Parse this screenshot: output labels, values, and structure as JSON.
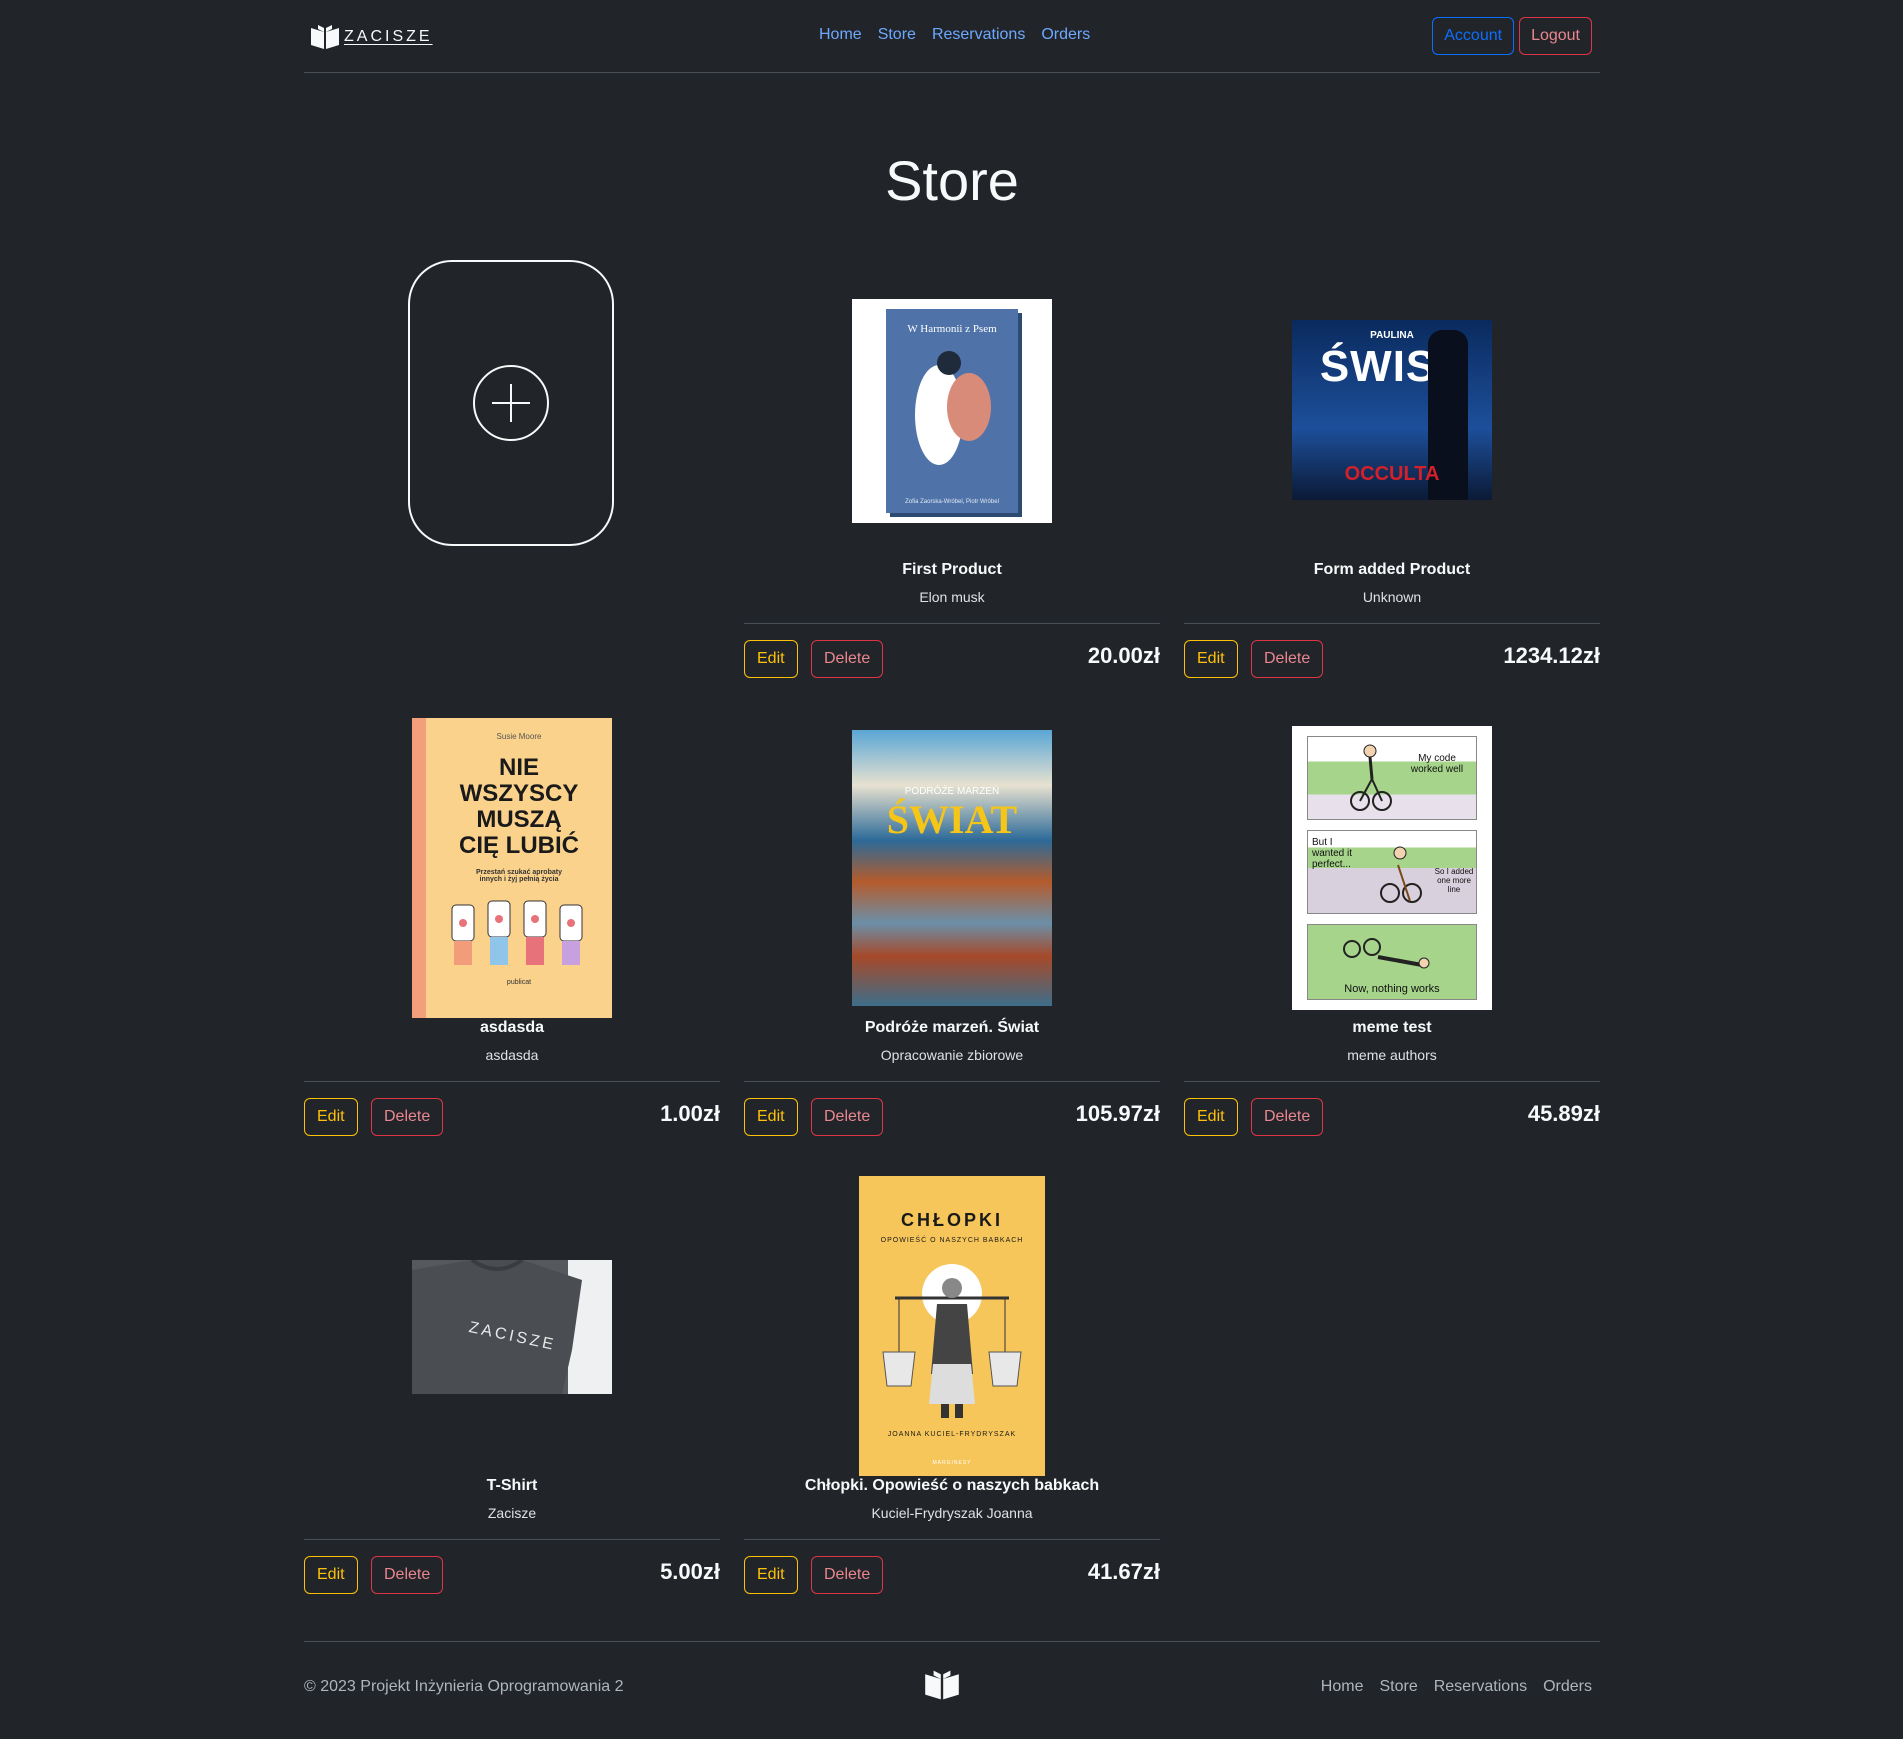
{
  "brand": {
    "name": "ZACISZE"
  },
  "nav": {
    "home": "Home",
    "store": "Store",
    "reservations": "Reservations",
    "orders": "Orders"
  },
  "header": {
    "account": "Account",
    "logout": "Logout"
  },
  "page": {
    "title": "Store"
  },
  "actions": {
    "edit": "Edit",
    "delete": "Delete"
  },
  "products": [
    {
      "name": "First Product",
      "author": "Elon musk",
      "price": "20.00zł",
      "cover_title": "W Harmonii z Psem",
      "cover_authors": "Zofia Zaorska-Wróbel, Piotr Wróbel"
    },
    {
      "name": "Form added Product",
      "author": "Unknown",
      "price": "1234.12zł",
      "cover_author": "PAULINA",
      "cover_title": "ŚWIST",
      "cover_sub": "OCCULTA"
    },
    {
      "name": "asdasda",
      "author": "asdasda",
      "price": "1.00zł",
      "cover_author": "Susie Moore",
      "cover_title": "NIE WSZYSCY MUSZĄ CIĘ LUBIĆ",
      "cover_sub": "Przestań szukać aprobaty innych i żyj pełnią życia",
      "cover_publisher": "publicat"
    },
    {
      "name": "Podróże marzeń. Świat",
      "author": "Opracowanie zbiorowe",
      "price": "105.97zł",
      "cover_sub": "PODRÓŻE MARZEŃ",
      "cover_title": "ŚWIAT"
    },
    {
      "name": "meme test",
      "author": "meme authors",
      "price": "45.89zł",
      "panel1": "My code worked well",
      "panel2a": "But I wanted it perfect...",
      "panel2b": "So I added one more line",
      "panel3": "Now, nothing works"
    },
    {
      "name": "T-Shirt",
      "author": "Zacisze",
      "price": "5.00zł",
      "shirt_text": "ZACISZE"
    },
    {
      "name": "Chłopki. Opowieść o naszych babkach",
      "author": "Kuciel-Frydryszak Joanna",
      "price": "41.67zł",
      "cover_title": "CHŁOPKI",
      "cover_sub": "OPOWIEŚĆ O NASZYCH BABKACH",
      "cover_author": "JOANNA KUCIEL-FRYDRYSZAK",
      "cover_publisher": "MARGINESY"
    }
  ],
  "footer": {
    "copyright": "© 2023 Projekt Inżynieria Oprogramowania 2"
  },
  "colors": {
    "background": "#212529",
    "link": "#6ea8fe",
    "edit": "#ffc107",
    "delete": "#dc3545",
    "account": "#0d6efd"
  }
}
